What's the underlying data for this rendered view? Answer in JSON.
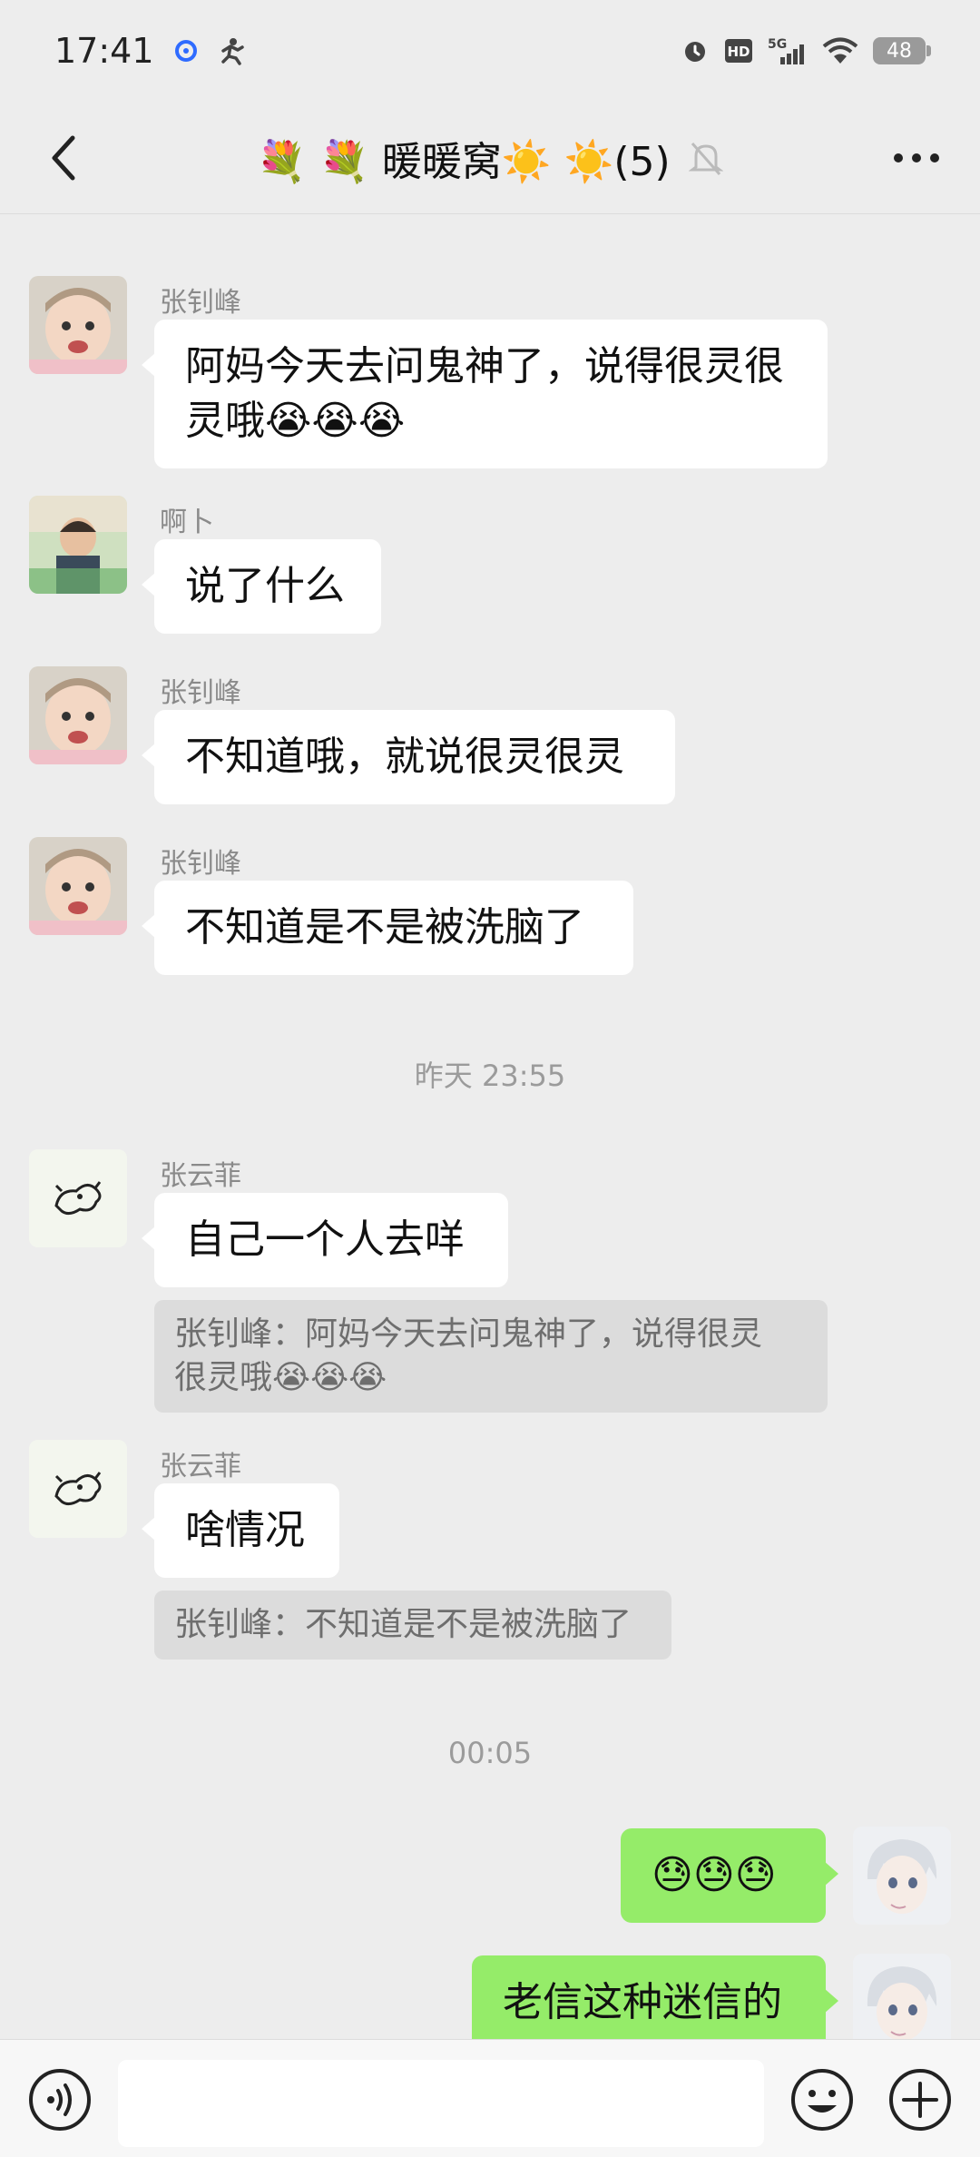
{
  "status": {
    "time": "17:41",
    "battery": "48"
  },
  "nav": {
    "title": "💐 💐 暖暖窝☀️ ☀️(5)",
    "icons": [
      "back-arrow-icon",
      "mute-bell-icon",
      "more-icon"
    ]
  },
  "messages": [
    {
      "sender": "张钊峰",
      "lines": [
        "阿妈今天去问鬼神了，说得很灵很",
        "灵哦😭😭😭"
      ]
    },
    {
      "sender": "啊卜",
      "text": "说了什么"
    },
    {
      "sender": "张钊峰",
      "text": "不知道哦，就说很灵很灵"
    },
    {
      "sender": "张钊峰",
      "text": "不知道是不是被洗脑了"
    }
  ],
  "timestamps": [
    "昨天 23:55",
    "00:05"
  ],
  "messages2": [
    {
      "sender": "张云菲",
      "text": "自己一个人去咩",
      "quote_lines": [
        "张钊峰：阿妈今天去问鬼神了，说得很灵",
        "很灵哦😭😭😭"
      ]
    },
    {
      "sender": "张云菲",
      "text": "啥情况",
      "quote": "张钊峰：不知道是不是被洗脑了"
    }
  ],
  "my_messages": [
    {
      "text": "😓😓😓"
    },
    {
      "text": "老信这种迷信的"
    }
  ],
  "input": {
    "icons": [
      "voice-icon",
      "emoji-icon",
      "plus-icon"
    ]
  }
}
